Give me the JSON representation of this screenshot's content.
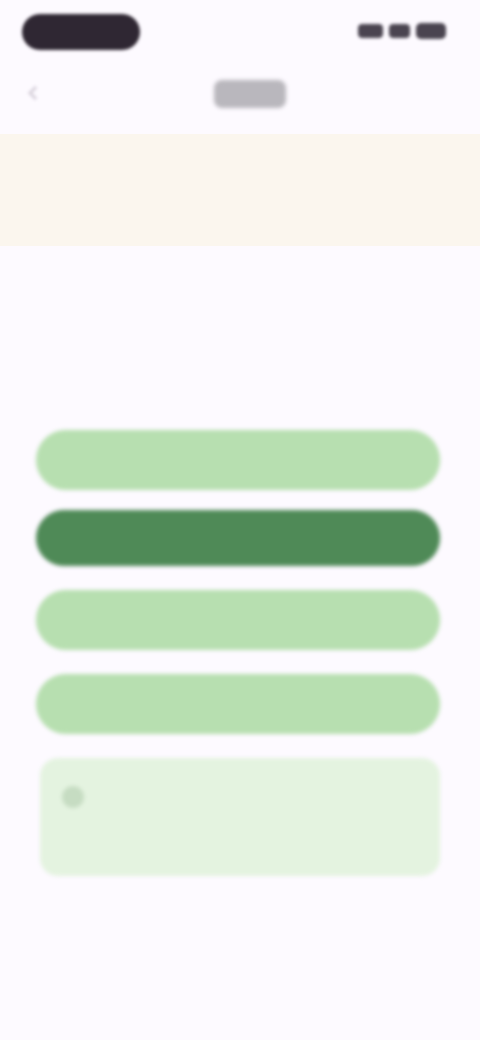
{
  "colors": {
    "background": "#fdfaff",
    "banner": "#fbf6ee",
    "option": "#b7dfb0",
    "option_selected": "#4f8a57",
    "hint_card": "#e4f3e0",
    "status_pill": "#2f2733"
  },
  "icons": {
    "back": "chevron-left-icon",
    "hint": "info-icon",
    "signal": "signal-icon",
    "wifi": "wifi-icon",
    "battery": "battery-icon"
  },
  "nav": {
    "back_label": "",
    "title": ""
  },
  "banner": {
    "text": ""
  },
  "section": {
    "label": ""
  },
  "question": {
    "text": ""
  },
  "options": [
    {
      "label": "",
      "selected": false
    },
    {
      "label": "",
      "selected": true
    },
    {
      "label": "",
      "selected": false
    },
    {
      "label": "",
      "selected": false
    }
  ],
  "hint": {
    "text": ""
  }
}
